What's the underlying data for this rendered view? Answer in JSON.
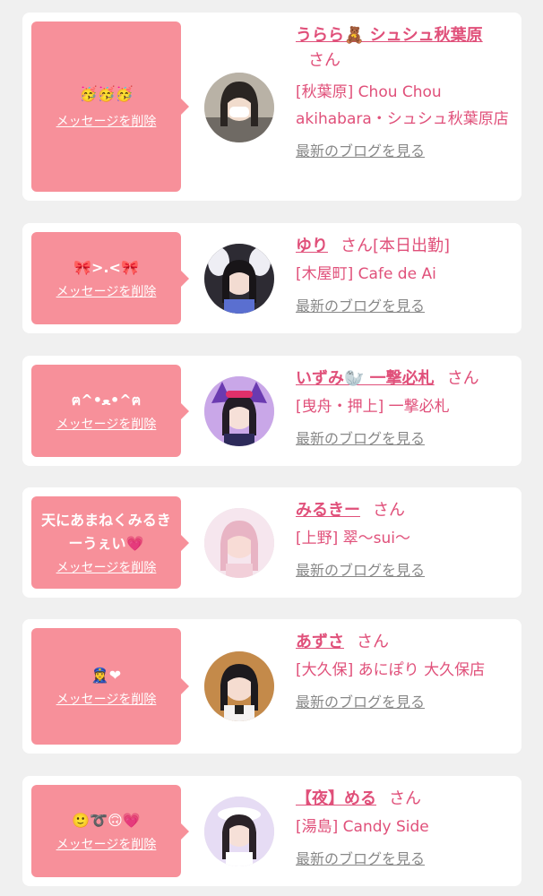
{
  "entries": [
    {
      "message": "🥳🥳🥳",
      "delete_label": "メッセージを削除",
      "name": "うらら🧸 シュシュ秋葉原",
      "honorific": "さん",
      "status": "",
      "shop": "[秋葉原] Chou Chou akihabara・シュシュ秋葉原店",
      "blog_label": "最新のブログを見る"
    },
    {
      "message": "🎀>.<🎀",
      "delete_label": "メッセージを削除",
      "name": "ゆり",
      "honorific": "さん",
      "status": "[本日出勤]",
      "shop": "[木屋町] Cafe de Ai",
      "blog_label": "最新のブログを見る"
    },
    {
      "message": "ฅ^•ﻌ•^ฅ",
      "delete_label": "メッセージを削除",
      "name": "いずみ🦭 一撃必札",
      "honorific": "さん",
      "status": "",
      "shop": "[曳舟・押上] 一撃必札",
      "blog_label": "最新のブログを見る"
    },
    {
      "message": "天にあまねくみるきーうぇい💗",
      "delete_label": "メッセージを削除",
      "name": "みるきー",
      "honorific": "さん",
      "status": "",
      "shop": "[上野] 翠〜sui〜",
      "blog_label": "最新のブログを見る"
    },
    {
      "message": "👮‍♀️❤",
      "delete_label": "メッセージを削除",
      "name": "あずさ",
      "honorific": "さん",
      "status": "",
      "shop": "[大久保] あにぽり 大久保店",
      "blog_label": "最新のブログを見る"
    },
    {
      "message": "🙂➰🙃💗",
      "delete_label": "メッセージを削除",
      "name": "【夜】める",
      "honorific": "さん",
      "status": "",
      "shop": "[湯島] Candy Side",
      "blog_label": "最新のブログを見る"
    }
  ],
  "colors": {
    "accent": "#e0507a",
    "bubble": "#f7909a",
    "link_gray": "#888888"
  }
}
